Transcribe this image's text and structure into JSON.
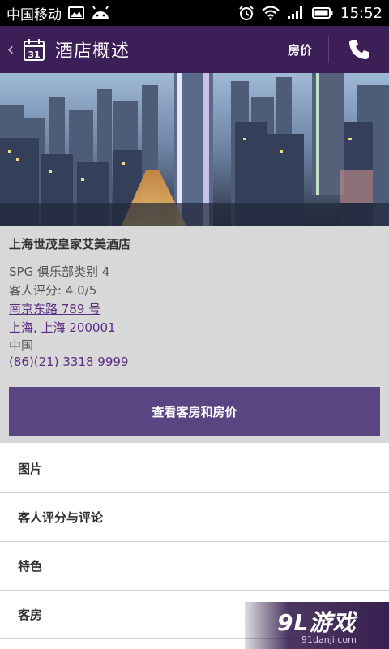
{
  "status_bar": {
    "carrier": "中国移动",
    "time": "15:52",
    "icons": [
      "image-notification-icon",
      "android-icon",
      "alarm-icon",
      "wifi-icon",
      "signal-icon",
      "battery-icon"
    ]
  },
  "action_bar": {
    "back_icon": "chevron-left-icon",
    "calendar_day": "31",
    "title": "酒店概述",
    "price_label": "房价",
    "phone_icon": "phone-icon",
    "color": "#3d1f57"
  },
  "hotel": {
    "name": "上海世茂皇家艾美酒店",
    "category": "SPG 俱乐部类别 4",
    "rating": "客人评分: 4.0/5",
    "address_line1": "南京东路 789 号",
    "address_line2": "上海, 上海 200001",
    "country": "中国",
    "phone": "(86)(21) 3318 9999"
  },
  "rooms_button": {
    "label": "查看客房和房价",
    "color": "#5a4583"
  },
  "menu": [
    {
      "label": "图片"
    },
    {
      "label": "客人评分与评论"
    },
    {
      "label": "特色"
    },
    {
      "label": "客房"
    }
  ],
  "watermark": {
    "logo": "9L游戏",
    "url": "91danji.com"
  }
}
